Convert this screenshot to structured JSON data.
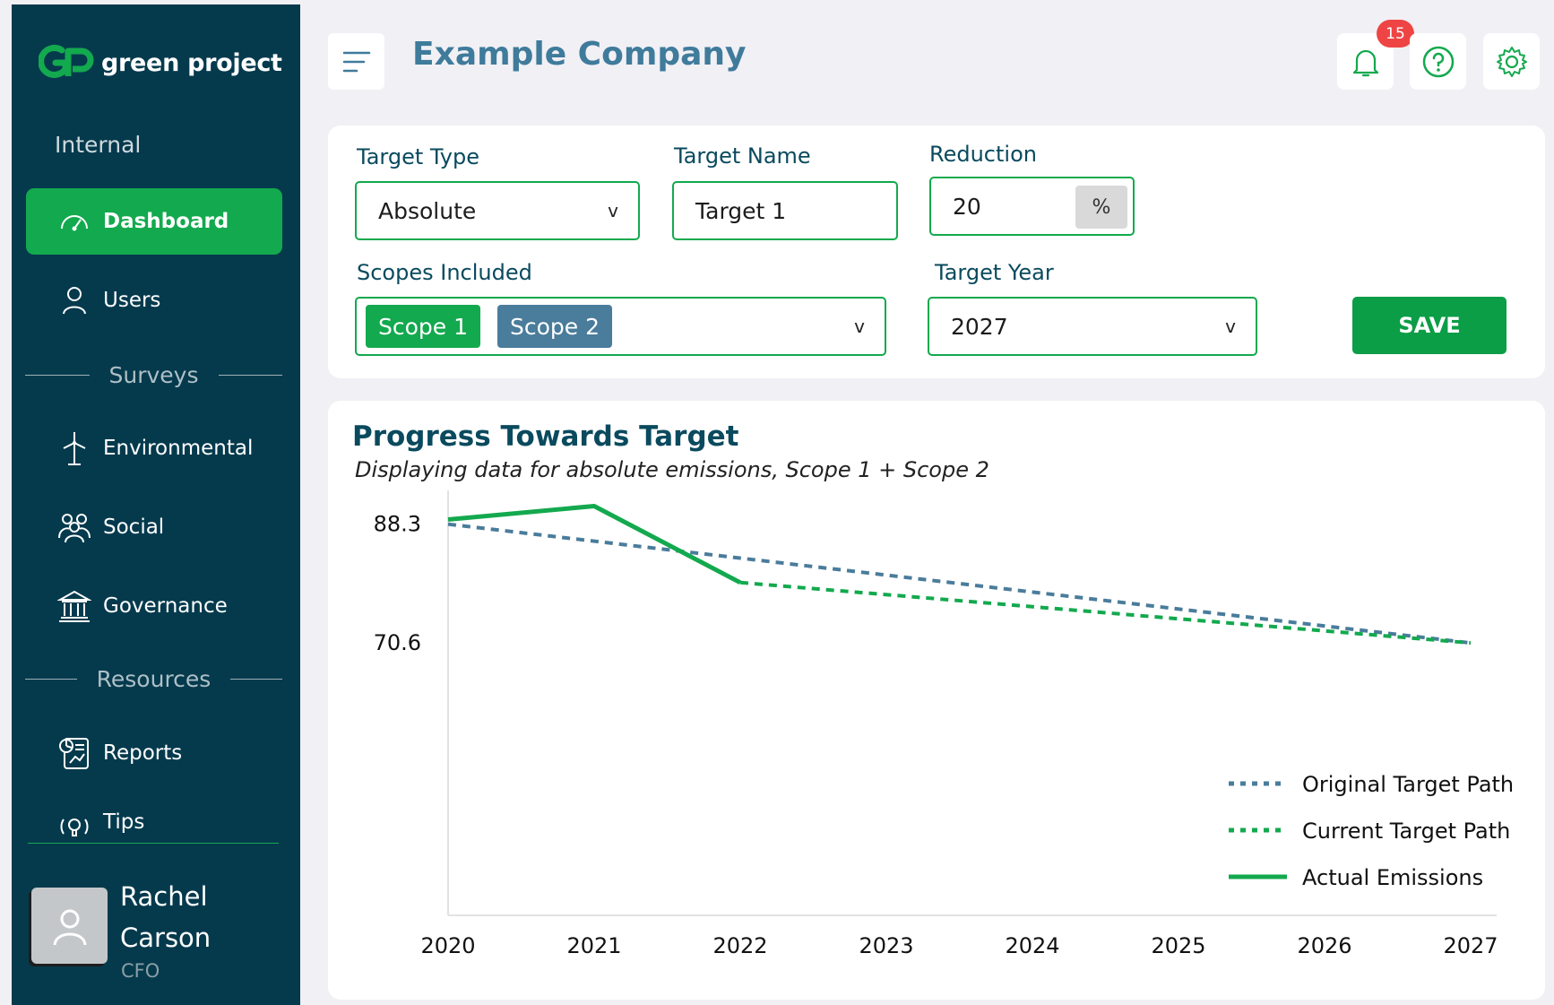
{
  "brand": {
    "name": "green project",
    "logo_text": "GP"
  },
  "sidebar": {
    "section_internal": "Internal",
    "items_internal": [
      {
        "label": "Dashboard",
        "icon": "gauge-icon",
        "active": true
      },
      {
        "label": "Users",
        "icon": "user-icon",
        "active": false
      }
    ],
    "section_surveys": "Surveys",
    "items_surveys": [
      {
        "label": "Environmental",
        "icon": "wind-turbine-icon"
      },
      {
        "label": "Social",
        "icon": "people-icon"
      },
      {
        "label": "Governance",
        "icon": "building-icon"
      }
    ],
    "section_resources": "Resources",
    "items_resources": [
      {
        "label": "Reports",
        "icon": "report-icon"
      },
      {
        "label": "Tips",
        "icon": "lightbulb-icon"
      }
    ]
  },
  "user": {
    "name": "Rachel Carson",
    "role": "CFO"
  },
  "header": {
    "company": "Example Company",
    "notification_count": "15"
  },
  "form": {
    "target_type_label": "Target Type",
    "target_type_value": "Absolute",
    "target_name_label": "Target Name",
    "target_name_value": "Target 1",
    "reduction_label": "Reduction",
    "reduction_value": "20",
    "reduction_unit": "%",
    "scopes_label": "Scopes Included",
    "scopes": [
      "Scope 1",
      "Scope 2"
    ],
    "target_year_label": "Target Year",
    "target_year_value": "2027",
    "save_label": "SAVE",
    "chevron": "v"
  },
  "colors": {
    "brand_green": "#13a94e",
    "sidebar_bg": "#053a4d",
    "scope1_chip": "#13a94e",
    "scope2_chip": "#4a7c9b",
    "original_path": "#4a7c9b",
    "current_path": "#13a94e",
    "actual_emissions": "#13a94e"
  },
  "chart_data": {
    "type": "line",
    "title": "Progress Towards Target",
    "subtitle": "Displaying data for absolute emissions, Scope 1 + Scope 2",
    "x": [
      "2020",
      "2021",
      "2022",
      "2023",
      "2024",
      "2025",
      "2026",
      "2027"
    ],
    "y_ticks": [
      "88.3",
      "70.6"
    ],
    "ylim": [
      30,
      92
    ],
    "series": [
      {
        "name": "Original Target Path",
        "style": "dotted",
        "points": [
          {
            "x": "2020",
            "y": 88.3
          },
          {
            "x": "2027",
            "y": 70.6
          }
        ]
      },
      {
        "name": "Current Target Path",
        "style": "dotted",
        "points": [
          {
            "x": "2022",
            "y": 79.6
          },
          {
            "x": "2027",
            "y": 70.6
          }
        ]
      },
      {
        "name": "Actual Emissions",
        "style": "solid",
        "points": [
          {
            "x": "2020",
            "y": 89.0
          },
          {
            "x": "2021",
            "y": 91.0
          },
          {
            "x": "2022",
            "y": 79.6
          }
        ]
      }
    ],
    "legend_position": "bottom-right",
    "grid": false
  }
}
